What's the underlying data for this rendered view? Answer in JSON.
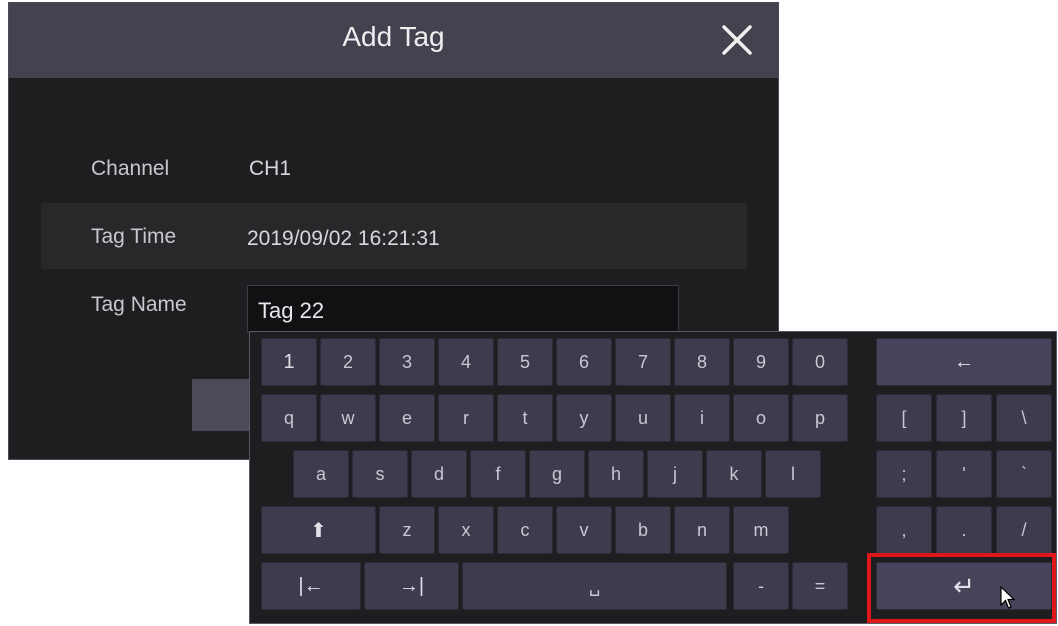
{
  "dialog": {
    "title": "Add Tag",
    "channel_label": "Channel",
    "channel_value": "CH1",
    "tag_time_label": "Tag Time",
    "tag_time_value": "2019/09/02 16:21:31",
    "tag_name_label": "Tag Name",
    "tag_name_value": "Tag 22"
  },
  "keyboard": {
    "row1": [
      "1",
      "2",
      "3",
      "4",
      "5",
      "6",
      "7",
      "8",
      "9",
      "0"
    ],
    "row2": [
      "q",
      "w",
      "e",
      "r",
      "t",
      "y",
      "u",
      "i",
      "o",
      "p"
    ],
    "row2_sym": [
      "[",
      "]",
      "\\"
    ],
    "row3": [
      "a",
      "s",
      "d",
      "f",
      "g",
      "h",
      "j",
      "k",
      "l"
    ],
    "row3_sym": [
      ";",
      "'",
      "`"
    ],
    "row4": [
      "z",
      "x",
      "c",
      "v",
      "b",
      "n",
      "m"
    ],
    "row4_sym": [
      ",",
      ".",
      "/"
    ],
    "backspace": "←",
    "shift": "⬆",
    "tab_left": "|←",
    "tab_right": "→|",
    "space": "␣",
    "minus": "-",
    "equals": "=",
    "enter": "↵"
  },
  "icons": {
    "close": "close-icon",
    "cursor": "mouse-pointer-icon"
  },
  "colors": {
    "highlight": "#e0161b",
    "titlebar": "#44424f",
    "key": "#3d3b4d"
  }
}
